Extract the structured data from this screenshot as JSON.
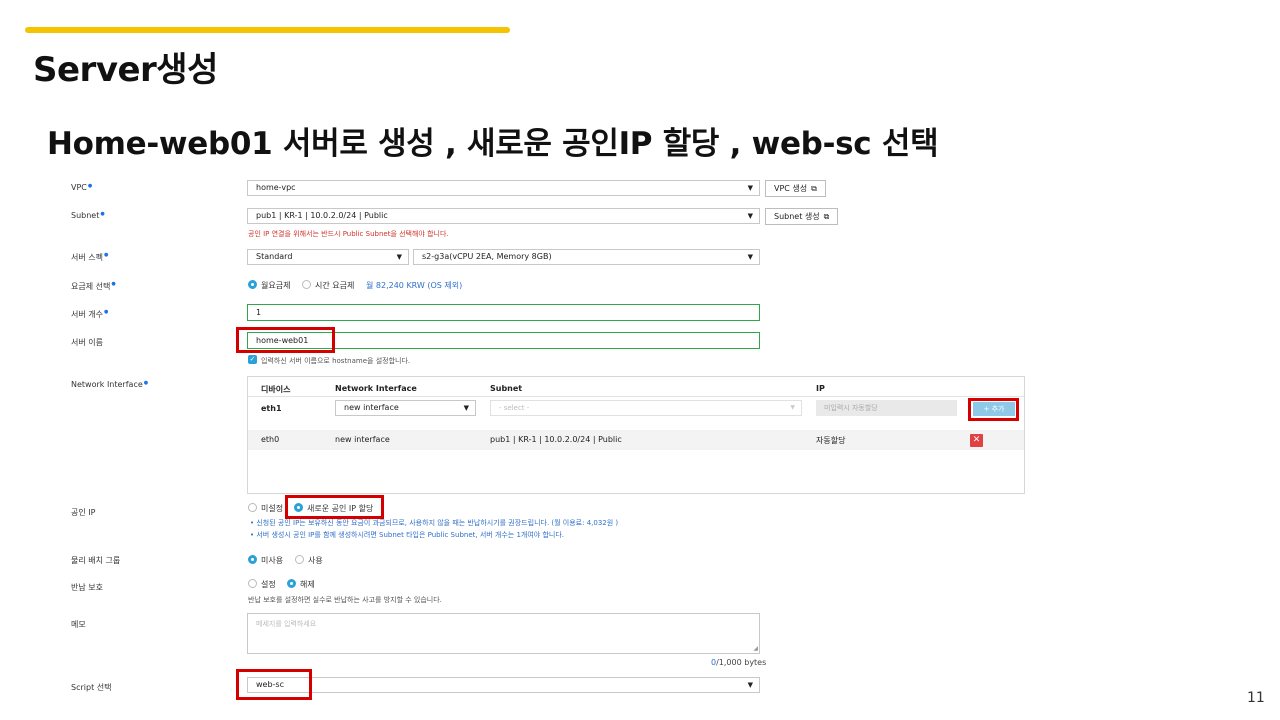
{
  "slide": {
    "title": "Server생성",
    "subtitle": "Home-web01 서버로 생성 , 새로운 공인IP 할당 , web-sc 선택",
    "page_number": "11",
    "accent_color": "#f5c400",
    "highlight_color": "#d40000"
  },
  "form": {
    "vpc": {
      "label": "VPC",
      "value": "home-vpc",
      "button": "VPC 생성"
    },
    "subnet": {
      "label": "Subnet",
      "value": "pub1 | KR-1 | 10.0.2.0/24 | Public",
      "button": "Subnet 생성",
      "warning": "공인 IP 연결을 위해서는 반드시 Public Subnet을 선택해야 합니다."
    },
    "server_spec": {
      "label": "서버 스펙",
      "type": "Standard",
      "spec": "s2-g3a(vCPU 2EA, Memory 8GB)"
    },
    "billing": {
      "label": "요금제 선택",
      "monthly": "월요금제",
      "hourly": "시간 요금제",
      "price": "월 82,240 KRW (OS 제외)"
    },
    "server_count": {
      "label": "서버 개수",
      "value": "1"
    },
    "server_name": {
      "label": "서버 이름",
      "value": "home-web01",
      "hostname_note": "입력하신 서버 이름으로 hostname을 설정합니다."
    },
    "network_interface": {
      "label": "Network Interface",
      "columns": [
        "디바이스",
        "Network Interface",
        "Subnet",
        "IP"
      ],
      "new_row": {
        "device": "eth1",
        "interface": "new interface",
        "subnet_placeholder": "- select -",
        "ip_placeholder": "미입력시 자동할당",
        "add_button": "+ 추가"
      },
      "rows": [
        {
          "device": "eth0",
          "interface": "new interface",
          "subnet": "pub1 | KR-1 | 10.0.2.0/24 | Public",
          "ip": "자동할당",
          "delete": "✕"
        }
      ]
    },
    "public_ip": {
      "label": "공인 IP",
      "option_none": "미설정",
      "option_new": "새로운 공인 IP 할당",
      "notes": [
        "신청된 공인 IP는 보유하신 동안 요금이 과금되므로, 사용하지 않을 때는 반납하시기를 권장드립니다. (월 이용료: 4,032원 )",
        "서버 생성시 공인 IP를 함께 생성하시려면 Subnet 타입은 Public Subnet, 서버 개수는 1개여야 합니다."
      ]
    },
    "placement_group": {
      "label": "물리 배치 그룹",
      "off": "미사용",
      "on": "사용"
    },
    "return_protection": {
      "label": "반납 보호",
      "set": "설정",
      "unset": "해제",
      "note": "반납 보호를 설정하면 실수로 반납하는 사고를 방지할 수 있습니다."
    },
    "memo": {
      "label": "메모",
      "placeholder": "메세지를 입력하세요",
      "count": "0",
      "limit": "/1,000 bytes"
    },
    "script": {
      "label": "Script 선택",
      "value": "web-sc"
    }
  }
}
